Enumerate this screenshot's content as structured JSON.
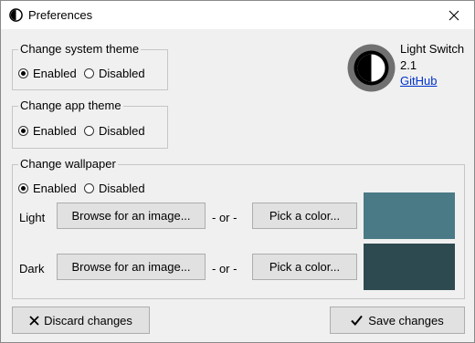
{
  "window": {
    "title": "Preferences",
    "icon": "light-switch-icon"
  },
  "system_theme": {
    "legend": "Change system theme",
    "enabled_label": "Enabled",
    "disabled_label": "Disabled",
    "selected": "enabled"
  },
  "app_theme": {
    "legend": "Change app theme",
    "enabled_label": "Enabled",
    "disabled_label": "Disabled",
    "selected": "enabled"
  },
  "wallpaper": {
    "legend": "Change wallpaper",
    "enabled_label": "Enabled",
    "disabled_label": "Disabled",
    "selected": "enabled",
    "rows": [
      {
        "label": "Light",
        "browse_label": "Browse for an image...",
        "or_label": "- or -",
        "pick_label": "Pick a color...",
        "color": "#4a7a85"
      },
      {
        "label": "Dark",
        "browse_label": "Browse for an image...",
        "or_label": "- or -",
        "pick_label": "Pick a color...",
        "color": "#2e4a51"
      }
    ]
  },
  "about": {
    "name": "Light Switch",
    "version": "2.1",
    "link_text": "GitHub"
  },
  "footer": {
    "discard_label": "Discard changes",
    "save_label": "Save changes"
  }
}
